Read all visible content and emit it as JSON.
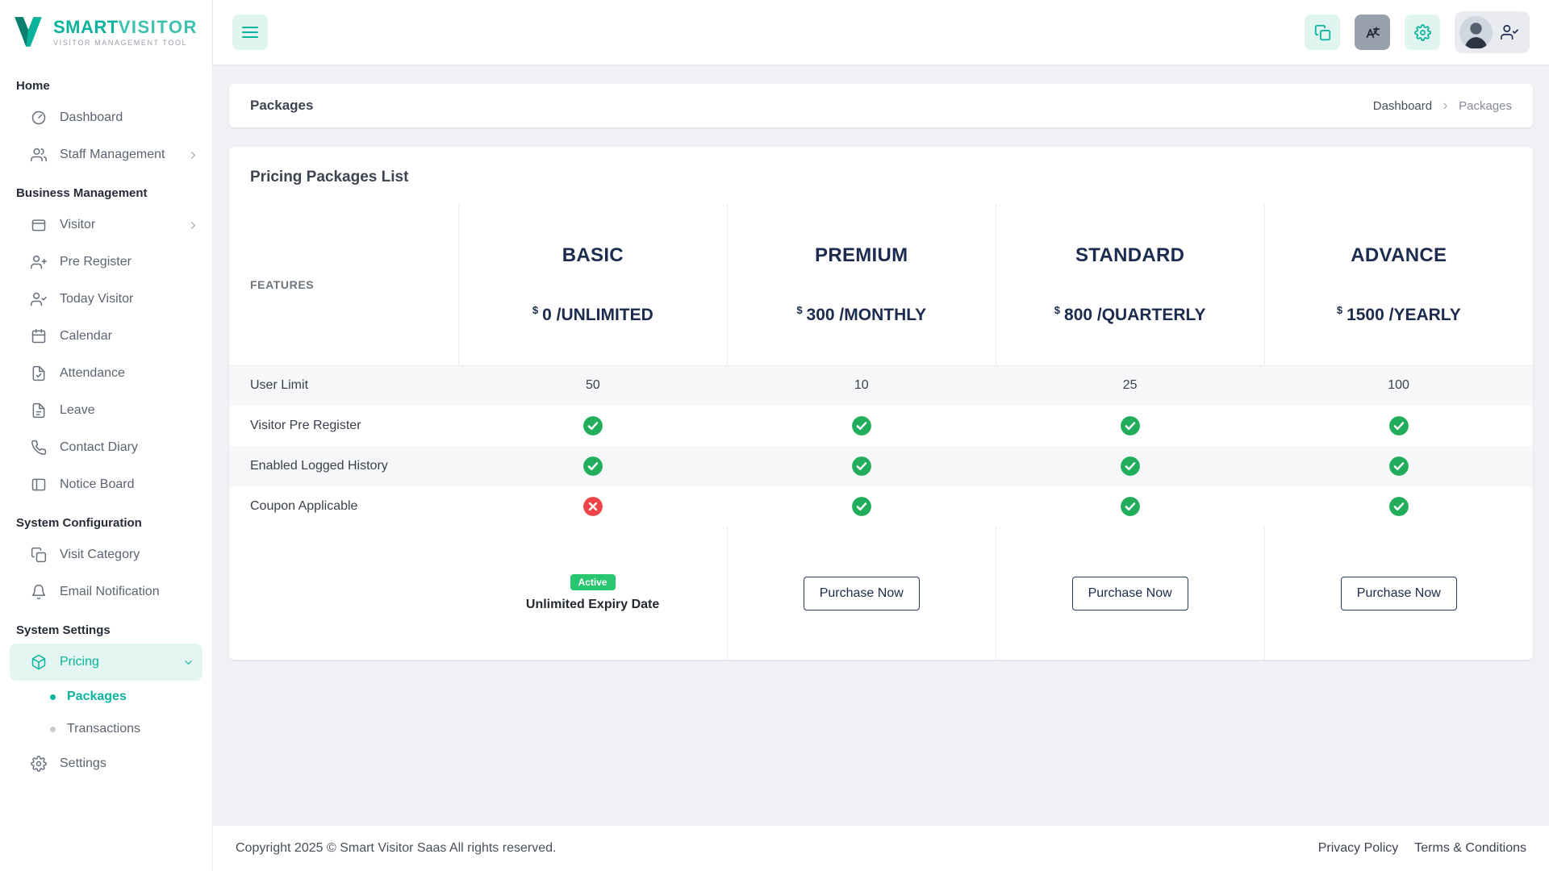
{
  "brand": {
    "name_primary": "SMART",
    "name_secondary": "VISITOR",
    "tagline": "VISITOR MANAGEMENT TOOL"
  },
  "colors": {
    "accent": "#0ab39c",
    "success": "#22ad5c",
    "danger": "#f04349",
    "badge_green": "#28c76f",
    "navy": "#1c2c4e"
  },
  "topbar": {
    "icons": [
      "hamburger-icon",
      "copy-icon",
      "translate-icon",
      "gear-icon",
      "avatar",
      "user-check-icon"
    ]
  },
  "sidebar": {
    "sections": [
      {
        "title": "Home",
        "items": [
          {
            "label": "Dashboard",
            "icon": "dashboard-icon"
          },
          {
            "label": "Staff Management",
            "icon": "users-icon",
            "chevron": "right"
          }
        ]
      },
      {
        "title": "Business Management",
        "items": [
          {
            "label": "Visitor",
            "icon": "visitor-card-icon",
            "chevron": "right"
          },
          {
            "label": "Pre Register",
            "icon": "user-plus-icon"
          },
          {
            "label": "Today Visitor",
            "icon": "user-check-icon"
          },
          {
            "label": "Calendar",
            "icon": "calendar-icon"
          },
          {
            "label": "Attendance",
            "icon": "file-check-icon"
          },
          {
            "label": "Leave",
            "icon": "file-icon"
          },
          {
            "label": "Contact Diary",
            "icon": "phone-icon"
          },
          {
            "label": "Notice Board",
            "icon": "board-icon"
          }
        ]
      },
      {
        "title": "System Configuration",
        "items": [
          {
            "label": "Visit Category",
            "icon": "copy-icon"
          },
          {
            "label": "Email Notification",
            "icon": "bell-icon"
          }
        ]
      },
      {
        "title": "System Settings",
        "items": [
          {
            "label": "Pricing",
            "icon": "package-icon",
            "chevron": "down",
            "active": true,
            "children": [
              {
                "label": "Packages",
                "active": true
              },
              {
                "label": "Transactions",
                "active": false
              }
            ]
          },
          {
            "label": "Settings",
            "icon": "gear-icon"
          }
        ]
      }
    ]
  },
  "breadcrumb": {
    "page_title": "Packages",
    "parent": "Dashboard",
    "current": "Packages"
  },
  "content": {
    "card_title": "Pricing Packages List"
  },
  "pricing_table": {
    "features_label": "FEATURES",
    "currency": "$",
    "plans": [
      {
        "name": "BASIC",
        "price": "0",
        "period": "/UNLIMITED",
        "status_badge": "Active",
        "status_text": "Unlimited Expiry Date"
      },
      {
        "name": "PREMIUM",
        "price": "300",
        "period": "/MONTHLY",
        "button_label": "Purchase Now"
      },
      {
        "name": "STANDARD",
        "price": "800",
        "period": "/QUARTERLY",
        "button_label": "Purchase Now"
      },
      {
        "name": "ADVANCE",
        "price": "1500",
        "period": "/YEARLY",
        "button_label": "Purchase Now"
      }
    ],
    "rows": [
      {
        "feature": "User Limit",
        "values": [
          "50",
          "10",
          "25",
          "100"
        ]
      },
      {
        "feature": "Visitor Pre Register",
        "values": [
          true,
          true,
          true,
          true
        ]
      },
      {
        "feature": "Enabled Logged History",
        "values": [
          true,
          true,
          true,
          true
        ]
      },
      {
        "feature": "Coupon Applicable",
        "values": [
          false,
          true,
          true,
          true
        ]
      }
    ]
  },
  "footer": {
    "copyright": "Copyright 2025 © Smart Visitor Saas All rights reserved.",
    "links": [
      {
        "label": "Privacy Policy"
      },
      {
        "label": "Terms & Conditions"
      }
    ]
  }
}
